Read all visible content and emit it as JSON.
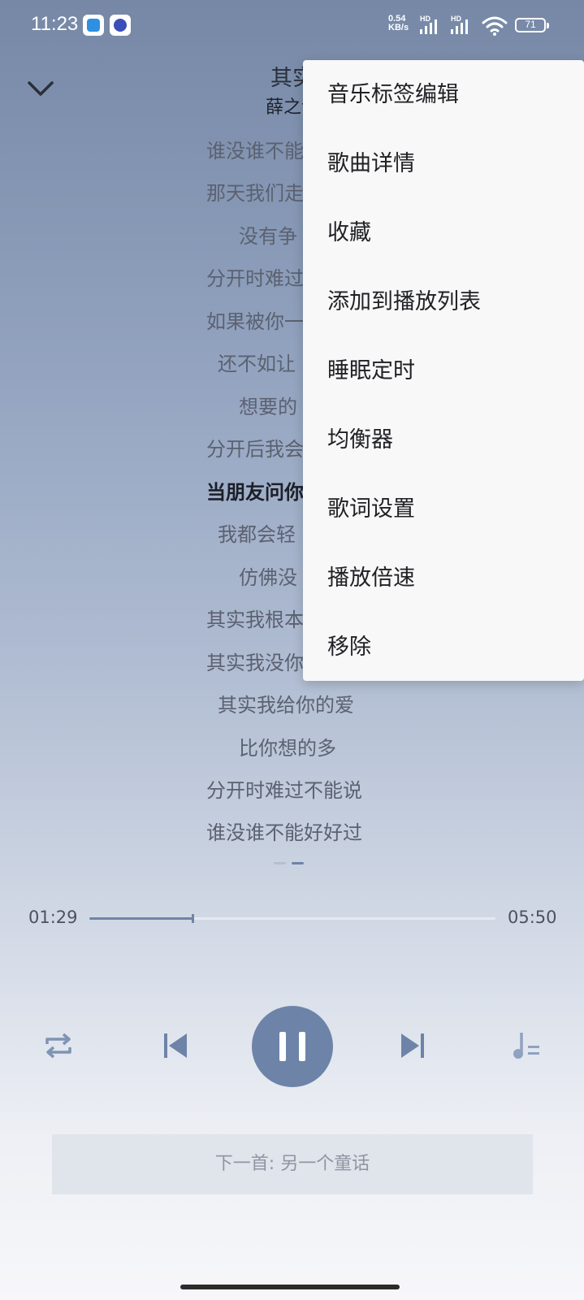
{
  "status_bar": {
    "time": "11:23",
    "net_speed_value": "0.54",
    "net_speed_unit": "KB/s",
    "signal1_label": "HD",
    "signal2_label": "HD",
    "battery": "71"
  },
  "header": {
    "title": "其实",
    "artist": "薛之谦"
  },
  "lyrics": [
    {
      "text": "谁没谁不能"
    },
    {
      "text": "那天我们走"
    },
    {
      "text": "没有争"
    },
    {
      "text": "分开时难过"
    },
    {
      "text": "如果被你一"
    },
    {
      "text": "还不如让"
    },
    {
      "text": "想要的"
    },
    {
      "text": "分开后我会"
    },
    {
      "text": "当朋友问你",
      "active": true
    },
    {
      "text": "我都会轻"
    },
    {
      "text": "仿佛没"
    },
    {
      "text": "其实我根本"
    },
    {
      "text": "其实我没你"
    },
    {
      "text": "其实我给你的爱"
    },
    {
      "text": "比你想的多"
    },
    {
      "text": "分开时难过不能说"
    },
    {
      "text": "谁没谁不能好好过"
    }
  ],
  "progress": {
    "current": "01:29",
    "total": "05:50",
    "fraction": 0.254
  },
  "next_song": "下一首: 另一个童话",
  "menu": {
    "items": [
      "音乐标签编辑",
      "歌曲详情",
      "收藏",
      "添加到播放列表",
      "睡眠定时",
      "均衡器",
      "歌词设置",
      "播放倍速",
      "移除"
    ]
  },
  "colors": {
    "accent": "#6d84a8",
    "menu_bg": "#f8f8f9"
  },
  "icons": {
    "collapse": "chevron-down-icon",
    "repeat": "repeat-icon",
    "prev": "skip-previous-icon",
    "play_pause": "pause-icon",
    "next": "skip-next-icon",
    "playlist": "playlist-icon"
  }
}
